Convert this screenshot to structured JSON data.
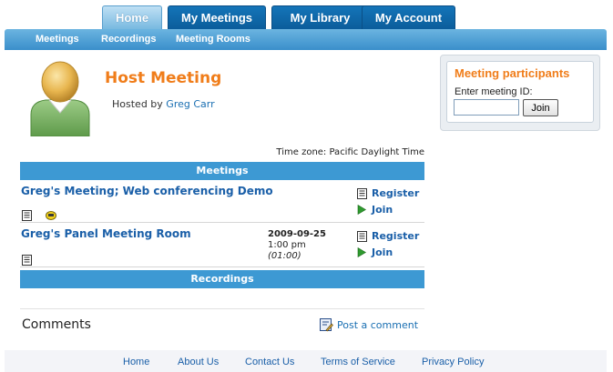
{
  "tabs": [
    {
      "label": "Home",
      "active": true
    },
    {
      "label": "My Meetings",
      "active": false
    },
    {
      "label": "My Library",
      "active": false
    },
    {
      "label": "My Account",
      "active": false
    }
  ],
  "subnav": [
    "Meetings",
    "Recordings",
    "Meeting Rooms"
  ],
  "host": {
    "title": "Host Meeting",
    "hosted_by_prefix": "Hosted by",
    "host_name": "Greg Carr"
  },
  "participants": {
    "title": "Meeting participants",
    "label": "Enter meeting ID:",
    "input_value": "",
    "join_label": "Join"
  },
  "timezone": "Time zone: Pacific Daylight Time",
  "meetings": {
    "header": "Meetings",
    "rows": [
      {
        "name": "Greg's Meeting; Web conferencing Demo",
        "date": "",
        "time": "",
        "duration": "",
        "icons": [
          "document-icon",
          "phone-icon"
        ],
        "register_label": "Register",
        "join_label": "Join"
      },
      {
        "name": "Greg's Panel Meeting Room",
        "date": "2009-09-25",
        "time": "1:00 pm",
        "duration": "(01:00)",
        "icons": [
          "document-icon"
        ],
        "register_label": "Register",
        "join_label": "Join"
      }
    ]
  },
  "recordings": {
    "header": "Recordings"
  },
  "comments": {
    "title": "Comments",
    "post_label": "Post a comment"
  },
  "footer": [
    "Home",
    "About Us",
    "Contact Us",
    "Terms of Service",
    "Privacy Policy"
  ],
  "colors": {
    "tab_blue": "#0b5d9b",
    "subnav_blue": "#3a8fcb",
    "section_blue": "#3d99d3",
    "accent_orange": "#f07d1a",
    "link_blue": "#1a5fa8"
  }
}
